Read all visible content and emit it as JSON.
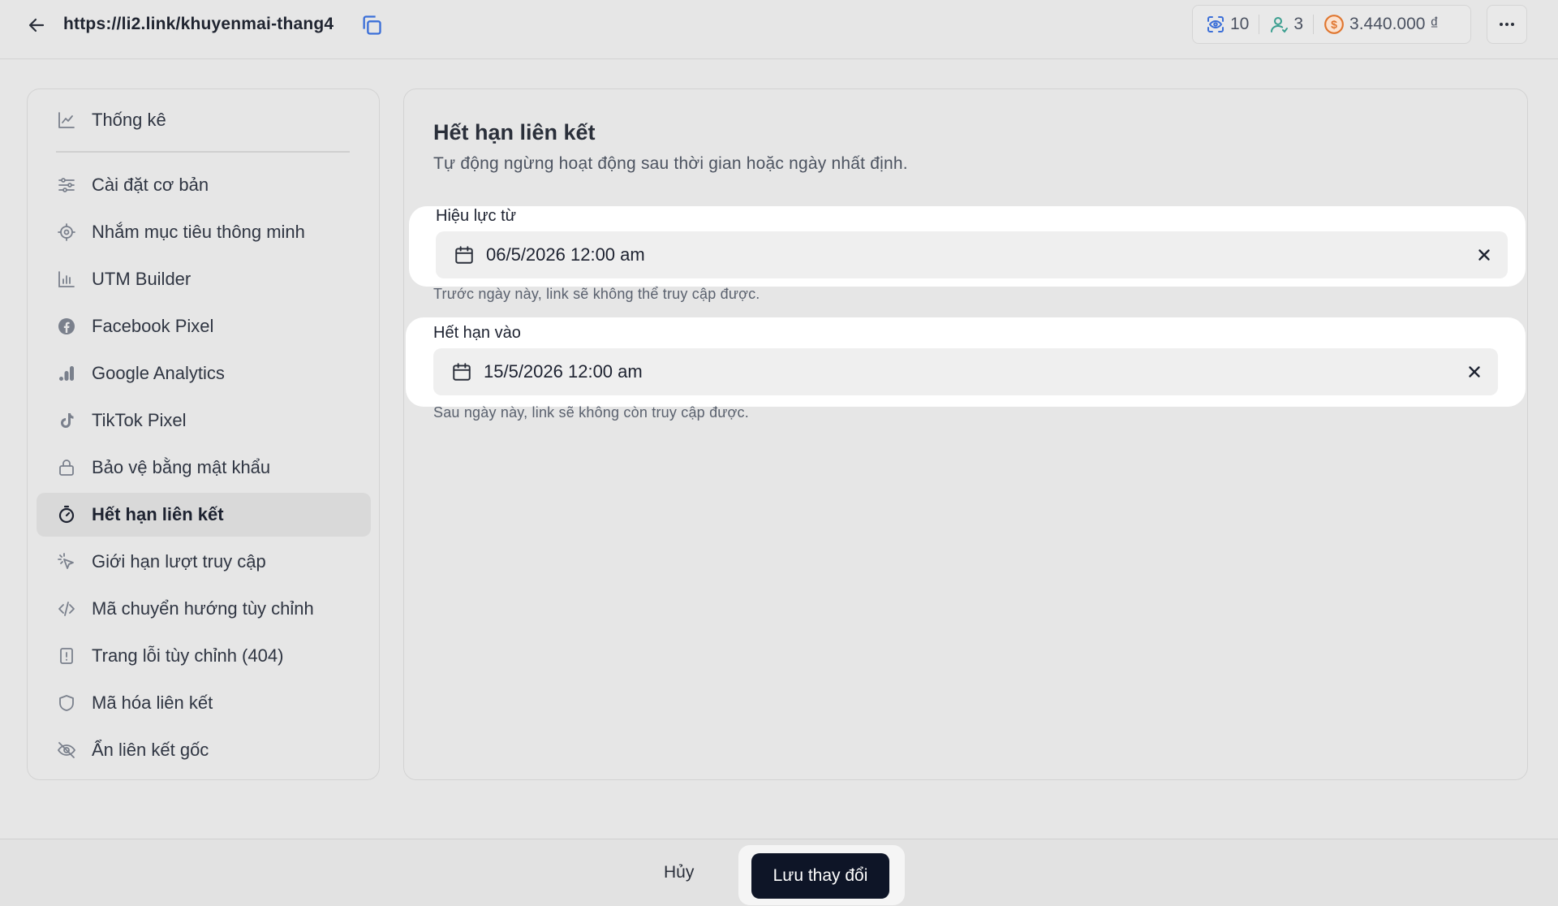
{
  "header": {
    "url": "https://li2.link/khuyenmai-thang4",
    "stats": {
      "views": "10",
      "users": "3",
      "revenue": "3.440.000 ₫"
    }
  },
  "sidebar": {
    "items": [
      {
        "label": "Thống kê",
        "icon": "chart-line-icon"
      },
      {
        "label": "Cài đặt cơ bản",
        "icon": "sliders-icon"
      },
      {
        "label": "Nhắm mục tiêu thông minh",
        "icon": "target-icon"
      },
      {
        "label": "UTM Builder",
        "icon": "bar-chart-icon"
      },
      {
        "label": "Facebook Pixel",
        "icon": "facebook-icon"
      },
      {
        "label": "Google Analytics",
        "icon": "google-analytics-icon"
      },
      {
        "label": "TikTok Pixel",
        "icon": "tiktok-icon"
      },
      {
        "label": "Bảo vệ bằng mật khẩu",
        "icon": "lock-icon"
      },
      {
        "label": "Hết hạn liên kết",
        "icon": "timer-icon",
        "active": true
      },
      {
        "label": "Giới hạn lượt truy cập",
        "icon": "click-icon"
      },
      {
        "label": "Mã chuyển hướng tùy chỉnh",
        "icon": "code-icon"
      },
      {
        "label": "Trang lỗi tùy chỉnh (404)",
        "icon": "file-alert-icon"
      },
      {
        "label": "Mã hóa liên kết",
        "icon": "shield-icon"
      },
      {
        "label": "Ẩn liên kết gốc",
        "icon": "eye-off-icon"
      }
    ]
  },
  "main": {
    "title": "Hết hạn liên kết",
    "subtitle": "Tự động ngừng hoạt động sau thời gian hoặc ngày nhất định.",
    "start": {
      "label": "Hiệu lực từ",
      "value": "06/5/2026 12:00 am",
      "help": "Trước ngày này, link sẽ không thể truy cập được."
    },
    "end": {
      "label": "Hết hạn vào",
      "value": "15/5/2026 12:00 am",
      "help": "Sau ngày này, link sẽ không còn truy cập được."
    }
  },
  "footer": {
    "cancel_label": "Hủy",
    "save_label": "Lưu thay đổi"
  },
  "colors": {
    "accent_dark": "#0e1527",
    "coin": "#e0762f",
    "users": "#3a9e8f",
    "views": "#3b6fd8"
  }
}
